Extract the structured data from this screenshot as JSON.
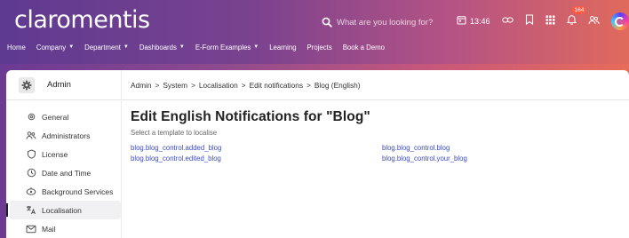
{
  "app": {
    "logo": "claromentis",
    "search_placeholder": "What are you looking for?",
    "time": "13:46",
    "notification_count": "164"
  },
  "nav": {
    "items": [
      {
        "label": "Home",
        "dropdown": false
      },
      {
        "label": "Company",
        "dropdown": true
      },
      {
        "label": "Department",
        "dropdown": true
      },
      {
        "label": "Dashboards",
        "dropdown": true
      },
      {
        "label": "E-Form Examples",
        "dropdown": true
      },
      {
        "label": "Learning",
        "dropdown": false
      },
      {
        "label": "Projects",
        "dropdown": false
      },
      {
        "label": "Book a Demo",
        "dropdown": false
      }
    ]
  },
  "sidebar": {
    "title": "Admin",
    "items": [
      {
        "label": "General",
        "icon": "gear-icon",
        "active": false
      },
      {
        "label": "Administrators",
        "icon": "users-icon",
        "active": false
      },
      {
        "label": "License",
        "icon": "shield-icon",
        "active": false
      },
      {
        "label": "Date and Time",
        "icon": "clock-icon",
        "active": false
      },
      {
        "label": "Background Services",
        "icon": "services-icon",
        "active": false
      },
      {
        "label": "Localisation",
        "icon": "translate-icon",
        "active": true
      },
      {
        "label": "Mail",
        "icon": "mail-icon",
        "active": false
      }
    ]
  },
  "breadcrumb": {
    "items": [
      "Admin",
      "System",
      "Localisation",
      "Edit notifications",
      "Blog (English)"
    ],
    "separator": ">"
  },
  "main": {
    "title": "Edit English Notifications for \"Blog\"",
    "subtitle": "Select a template to localise",
    "templates": [
      "blog.blog_control.added_blog",
      "blog.blog_control.blog",
      "blog.blog_control.edited_blog",
      "blog.blog_control.your_blog"
    ]
  },
  "colors": {
    "link": "#3b4bc2",
    "badge": "#ff5a44"
  }
}
